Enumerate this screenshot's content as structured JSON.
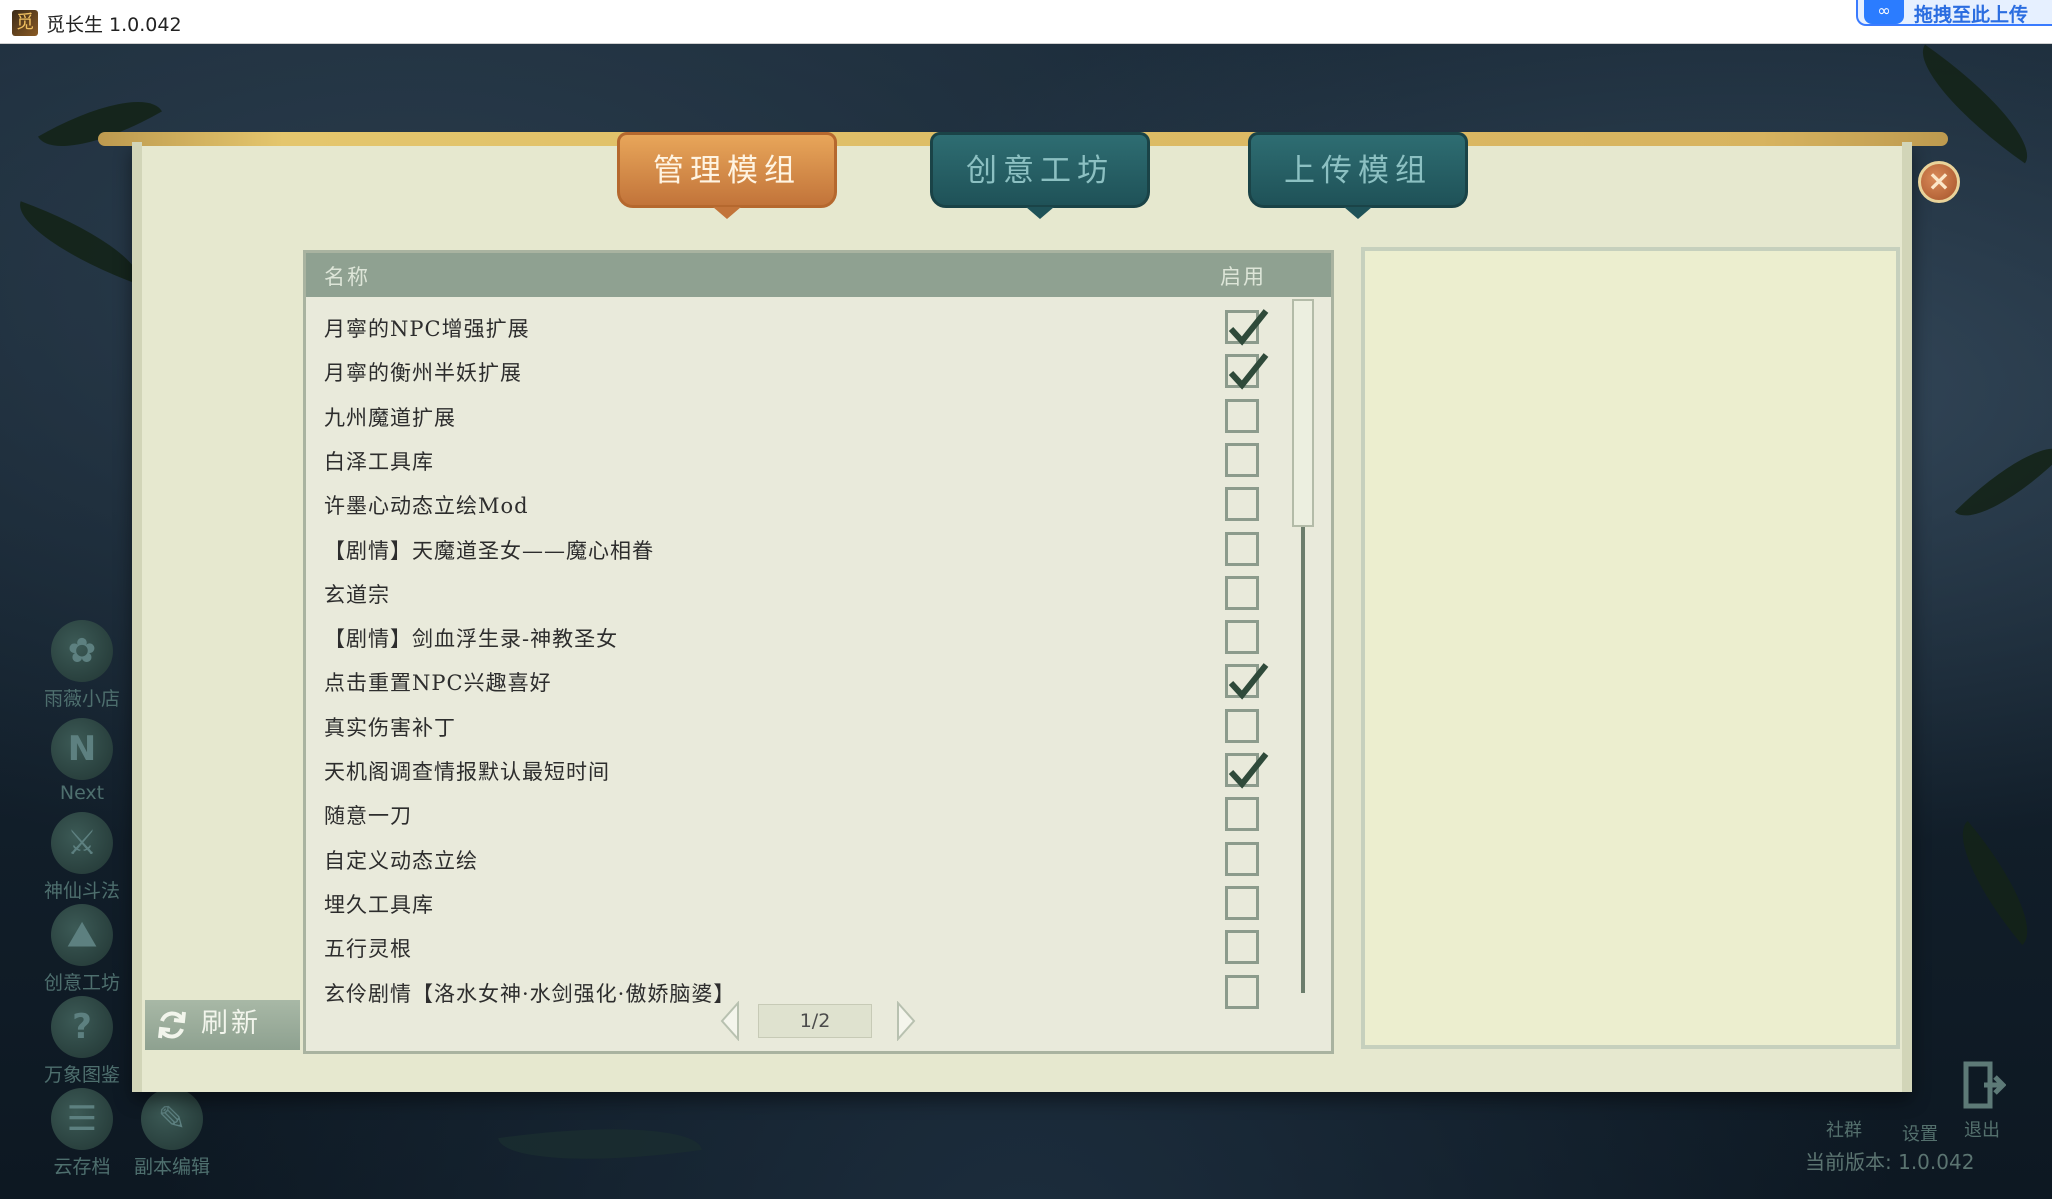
{
  "window": {
    "title": "觅长生 1.0.042",
    "upload_badge": "拖拽至此上传"
  },
  "tabs": [
    {
      "label": "管理模组",
      "active": true
    },
    {
      "label": "创意工坊",
      "active": false
    },
    {
      "label": "上传模组",
      "active": false
    }
  ],
  "close_icon": "×",
  "list": {
    "header_name": "名称",
    "header_enable": "启用",
    "rows": [
      {
        "name": "月寧的NPC增强扩展",
        "enabled": true
      },
      {
        "name": "月寧的衡州半妖扩展",
        "enabled": true
      },
      {
        "name": "九州魔道扩展",
        "enabled": false
      },
      {
        "name": "白泽工具库",
        "enabled": false
      },
      {
        "name": "许墨心动态立绘Mod",
        "enabled": false
      },
      {
        "name": "【剧情】天魔道圣女——魔心相眷",
        "enabled": false
      },
      {
        "name": "玄道宗",
        "enabled": false
      },
      {
        "name": "【剧情】剑血浮生录-神教圣女",
        "enabled": false
      },
      {
        "name": "点击重置NPC兴趣喜好",
        "enabled": true
      },
      {
        "name": "真实伤害补丁",
        "enabled": false
      },
      {
        "name": "天机阁调查情报默认最短时间",
        "enabled": true
      },
      {
        "name": "随意一刀",
        "enabled": false
      },
      {
        "name": "自定义动态立绘",
        "enabled": false
      },
      {
        "name": "埋久工具库",
        "enabled": false
      },
      {
        "name": "五行灵根",
        "enabled": false
      },
      {
        "name": "玄伶剧情【洛水女神·水剑强化·傲娇脑婆】",
        "enabled": false
      }
    ],
    "page": "1/2"
  },
  "refresh_label": "刷新",
  "side_menu": [
    {
      "label": "雨薇小店",
      "icon": "shop-icon",
      "glyph": "✿"
    },
    {
      "label": "Next",
      "icon": "next-icon",
      "glyph": "N"
    },
    {
      "label": "神仙斗法",
      "icon": "battle-icon",
      "glyph": "⚔"
    },
    {
      "label": "创意工坊",
      "icon": "workshop-icon",
      "glyph": "⛰"
    },
    {
      "label": "万象图鉴",
      "icon": "encyclopedia-icon",
      "glyph": "?"
    },
    {
      "label": "云存档",
      "icon": "cloud-save-icon",
      "glyph": "☰"
    },
    {
      "label": "副本编辑",
      "icon": "dungeon-editor-icon",
      "glyph": "✎"
    }
  ],
  "bottom_right": {
    "community": "社群",
    "settings": "设置",
    "exit": "退出",
    "version": "当前版本: 1.0.042"
  },
  "colors": {
    "tab_active": "#d58b48",
    "tab_inactive": "#27616a",
    "scroll_bg": "#e6e8cf",
    "header_bg": "#8fa191"
  }
}
